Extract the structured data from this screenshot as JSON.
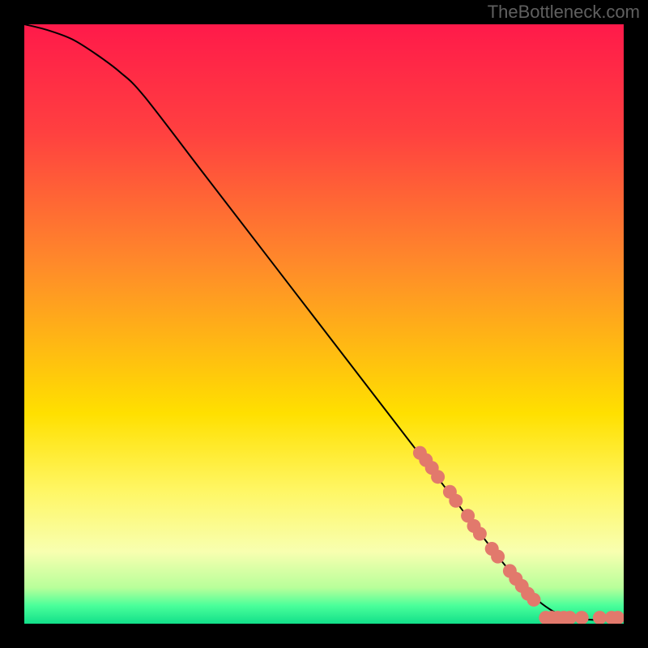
{
  "watermark": "TheBottleneck.com",
  "chart_data": {
    "type": "line",
    "title": "",
    "xlabel": "",
    "ylabel": "",
    "xlim": [
      0,
      100
    ],
    "ylim": [
      0,
      100
    ],
    "background_gradient_stops": [
      {
        "offset": 0,
        "color": "#ff1a4a"
      },
      {
        "offset": 0.18,
        "color": "#ff4040"
      },
      {
        "offset": 0.4,
        "color": "#ff8a2a"
      },
      {
        "offset": 0.65,
        "color": "#ffe000"
      },
      {
        "offset": 0.78,
        "color": "#fff766"
      },
      {
        "offset": 0.88,
        "color": "#f8ffb0"
      },
      {
        "offset": 0.94,
        "color": "#b8ff9a"
      },
      {
        "offset": 0.97,
        "color": "#4aff9a"
      },
      {
        "offset": 1.0,
        "color": "#12e08a"
      }
    ],
    "series": [
      {
        "name": "bottleneck-curve",
        "x": [
          0,
          4,
          8,
          12,
          16,
          20,
          30,
          40,
          50,
          60,
          70,
          80,
          85,
          88,
          90,
          92,
          94,
          96,
          98,
          100
        ],
        "y": [
          100,
          99,
          97.5,
          95,
          92,
          88,
          75,
          62,
          49,
          36,
          23,
          10,
          4.5,
          2.2,
          1.3,
          0.9,
          0.7,
          0.6,
          0.55,
          0.5
        ]
      }
    ],
    "markers": {
      "name": "highlighted-points",
      "color": "#e2796c",
      "points": [
        {
          "x": 66,
          "y": 28.5
        },
        {
          "x": 67,
          "y": 27.3
        },
        {
          "x": 68,
          "y": 26.0
        },
        {
          "x": 69,
          "y": 24.5
        },
        {
          "x": 71,
          "y": 22.0
        },
        {
          "x": 72,
          "y": 20.5
        },
        {
          "x": 74,
          "y": 18.0
        },
        {
          "x": 75,
          "y": 16.3
        },
        {
          "x": 76,
          "y": 15.0
        },
        {
          "x": 78,
          "y": 12.5
        },
        {
          "x": 79,
          "y": 11.2
        },
        {
          "x": 81,
          "y": 8.8
        },
        {
          "x": 82,
          "y": 7.5
        },
        {
          "x": 83,
          "y": 6.3
        },
        {
          "x": 84,
          "y": 5.0
        },
        {
          "x": 85,
          "y": 4.0
        },
        {
          "x": 87,
          "y": 1.0
        },
        {
          "x": 88,
          "y": 1.0
        },
        {
          "x": 89,
          "y": 1.0
        },
        {
          "x": 90,
          "y": 1.0
        },
        {
          "x": 91,
          "y": 1.0
        },
        {
          "x": 93,
          "y": 1.0
        },
        {
          "x": 96,
          "y": 1.0
        },
        {
          "x": 98,
          "y": 1.0
        },
        {
          "x": 99,
          "y": 1.0
        }
      ]
    }
  }
}
